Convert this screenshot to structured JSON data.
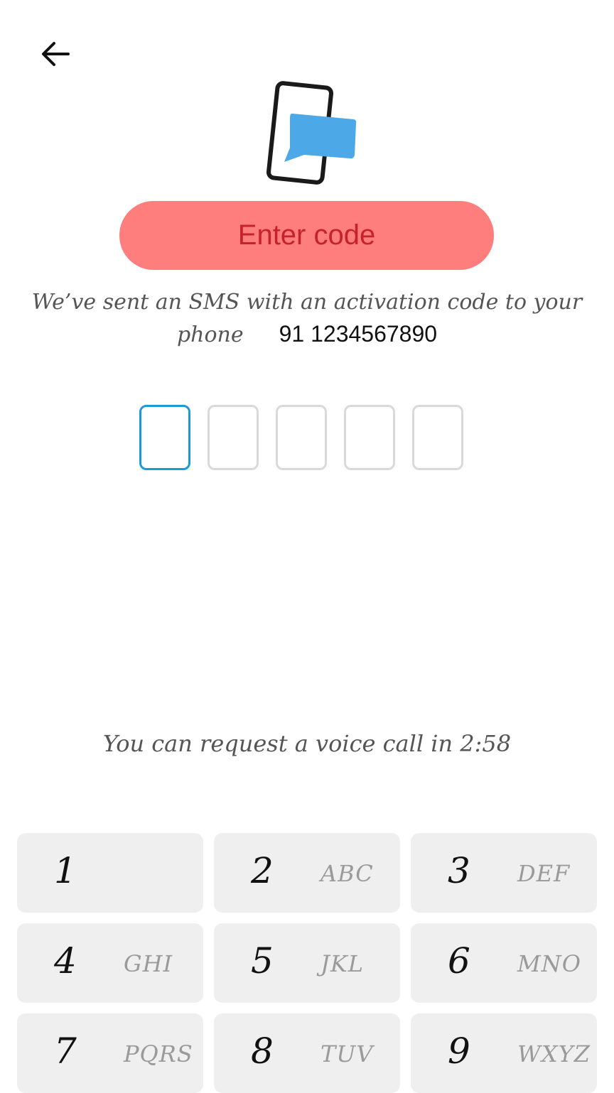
{
  "header": {
    "back_icon": "arrow-left-icon"
  },
  "hero": {
    "icon": "phone-message-icon",
    "colors": {
      "phone": "#1a1a1a",
      "bubble": "#4ca8e6"
    }
  },
  "title": "Enter code",
  "description": {
    "line1": "We’ve sent an SMS with an activation code to your",
    "line2": "phone",
    "phone_number": "91 1234567890"
  },
  "code": {
    "length": 5,
    "active_index": 0,
    "active_color": "#1a9bd7"
  },
  "voice_call": "You can request a voice call in 2:58",
  "keypad": {
    "keys": [
      {
        "digit": "1",
        "letters": ""
      },
      {
        "digit": "2",
        "letters": "ABC"
      },
      {
        "digit": "3",
        "letters": "DEF"
      },
      {
        "digit": "4",
        "letters": "GHI"
      },
      {
        "digit": "5",
        "letters": "JKL"
      },
      {
        "digit": "6",
        "letters": "MNO"
      },
      {
        "digit": "7",
        "letters": "PQRS"
      },
      {
        "digit": "8",
        "letters": "TUV"
      },
      {
        "digit": "9",
        "letters": "WXYZ"
      }
    ]
  },
  "colors": {
    "accent": "#fe7d7d",
    "title_text": "#c4232b",
    "key_bg": "#efefef"
  }
}
